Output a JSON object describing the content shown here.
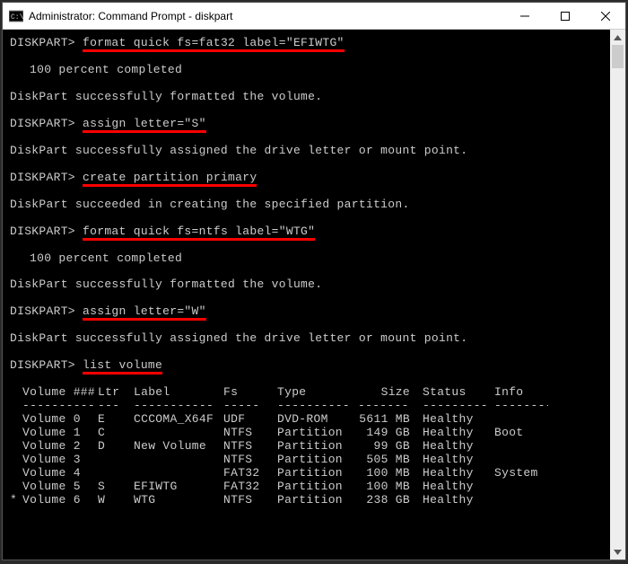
{
  "window": {
    "title": "Administrator: Command Prompt - diskpart"
  },
  "prompt": "DISKPART>",
  "lines": [
    {
      "type": "cmd",
      "text": "format quick fs=fat32 label=\"EFIWTG\"",
      "highlight": true
    },
    {
      "type": "blank"
    },
    {
      "type": "out",
      "text": "100 percent completed",
      "indent": true
    },
    {
      "type": "blank"
    },
    {
      "type": "out",
      "text": "DiskPart successfully formatted the volume."
    },
    {
      "type": "blank"
    },
    {
      "type": "cmd",
      "text": "assign letter=\"S\"",
      "highlight": true
    },
    {
      "type": "blank"
    },
    {
      "type": "out",
      "text": "DiskPart successfully assigned the drive letter or mount point."
    },
    {
      "type": "blank"
    },
    {
      "type": "cmd",
      "text": "create partition primary",
      "highlight": true
    },
    {
      "type": "blank"
    },
    {
      "type": "out",
      "text": "DiskPart succeeded in creating the specified partition."
    },
    {
      "type": "blank"
    },
    {
      "type": "cmd",
      "text": "format quick fs=ntfs label=\"WTG\"",
      "highlight": true
    },
    {
      "type": "blank"
    },
    {
      "type": "out",
      "text": "100 percent completed",
      "indent": true
    },
    {
      "type": "blank"
    },
    {
      "type": "out",
      "text": "DiskPart successfully formatted the volume."
    },
    {
      "type": "blank"
    },
    {
      "type": "cmd",
      "text": "assign letter=\"W\"",
      "highlight": true
    },
    {
      "type": "blank"
    },
    {
      "type": "out",
      "text": "DiskPart successfully assigned the drive letter or mount point."
    },
    {
      "type": "blank"
    },
    {
      "type": "cmd",
      "text": "list volume",
      "highlight": true
    },
    {
      "type": "blank"
    }
  ],
  "table": {
    "headers": {
      "vol": "Volume ###",
      "ltr": "Ltr",
      "lbl": "Label",
      "fs": "Fs",
      "typ": "Type",
      "sz": "Size",
      "st": "Status",
      "inf": "Info"
    },
    "sep": {
      "vol": "----------",
      "ltr": "---",
      "lbl": "-----------",
      "fs": "-----",
      "typ": "----------",
      "sz": "-------",
      "st": "---------",
      "inf": "--------"
    },
    "rows": [
      {
        "star": "",
        "vol": "Volume 0",
        "ltr": "E",
        "lbl": "CCCOMA_X64F",
        "fs": "UDF",
        "typ": "DVD-ROM",
        "sz": "5611 MB",
        "st": "Healthy",
        "inf": ""
      },
      {
        "star": "",
        "vol": "Volume 1",
        "ltr": "C",
        "lbl": "",
        "fs": "NTFS",
        "typ": "Partition",
        "sz": "149 GB",
        "st": "Healthy",
        "inf": "Boot"
      },
      {
        "star": "",
        "vol": "Volume 2",
        "ltr": "D",
        "lbl": "New Volume",
        "fs": "NTFS",
        "typ": "Partition",
        "sz": "99 GB",
        "st": "Healthy",
        "inf": ""
      },
      {
        "star": "",
        "vol": "Volume 3",
        "ltr": "",
        "lbl": "",
        "fs": "NTFS",
        "typ": "Partition",
        "sz": "505 MB",
        "st": "Healthy",
        "inf": ""
      },
      {
        "star": "",
        "vol": "Volume 4",
        "ltr": "",
        "lbl": "",
        "fs": "FAT32",
        "typ": "Partition",
        "sz": "100 MB",
        "st": "Healthy",
        "inf": "System"
      },
      {
        "star": "",
        "vol": "Volume 5",
        "ltr": "S",
        "lbl": "EFIWTG",
        "fs": "FAT32",
        "typ": "Partition",
        "sz": "100 MB",
        "st": "Healthy",
        "inf": ""
      },
      {
        "star": "*",
        "vol": "Volume 6",
        "ltr": "W",
        "lbl": "WTG",
        "fs": "NTFS",
        "typ": "Partition",
        "sz": "238 GB",
        "st": "Healthy",
        "inf": ""
      }
    ]
  }
}
